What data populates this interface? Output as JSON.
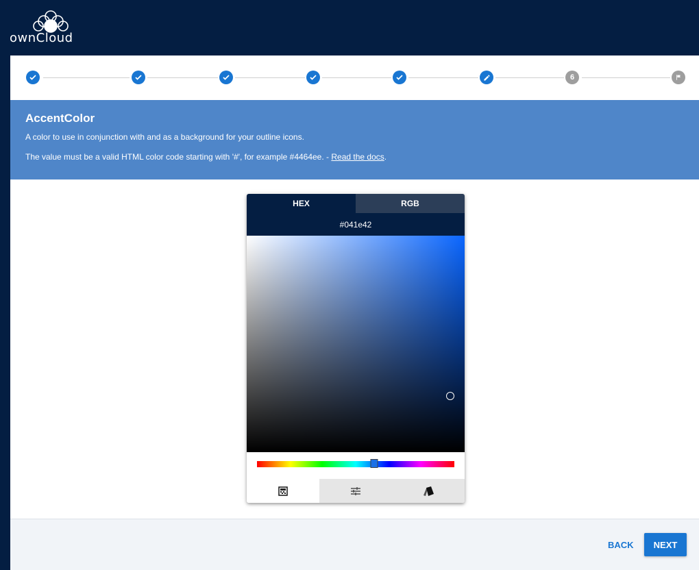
{
  "header": {
    "logo_text": "ownCloud"
  },
  "stepper": {
    "steps": [
      {
        "status": "done",
        "label": ""
      },
      {
        "status": "done",
        "label": ""
      },
      {
        "status": "done",
        "label": ""
      },
      {
        "status": "done",
        "label": ""
      },
      {
        "status": "done",
        "label": ""
      },
      {
        "status": "active",
        "label": ""
      },
      {
        "status": "pending",
        "label": "6"
      },
      {
        "status": "final",
        "label": ""
      }
    ]
  },
  "banner": {
    "title": "AccentColor",
    "description": "A color to use in conjunction with and as a background for your outline icons.",
    "hint": "The value must be a valid HTML color code starting with '#', for example #4464ee. - ",
    "docs_link": "Read the docs",
    "hint_suffix": "."
  },
  "color_picker": {
    "tabs": [
      "HEX",
      "RGB"
    ],
    "active_tab": "HEX",
    "hex_value": "#041e42",
    "hue_color": "#0a66ff",
    "selected_color": "#041e42",
    "modes": [
      {
        "icon": "palette-swatch-icon",
        "active": true
      },
      {
        "icon": "sliders-icon",
        "active": false
      },
      {
        "icon": "color-cards-icon",
        "active": false
      }
    ]
  },
  "footer": {
    "back_label": "BACK",
    "next_label": "NEXT"
  },
  "colors": {
    "brand_dark": "#041e42",
    "primary": "#1976d2",
    "banner": "#4f86c9"
  }
}
